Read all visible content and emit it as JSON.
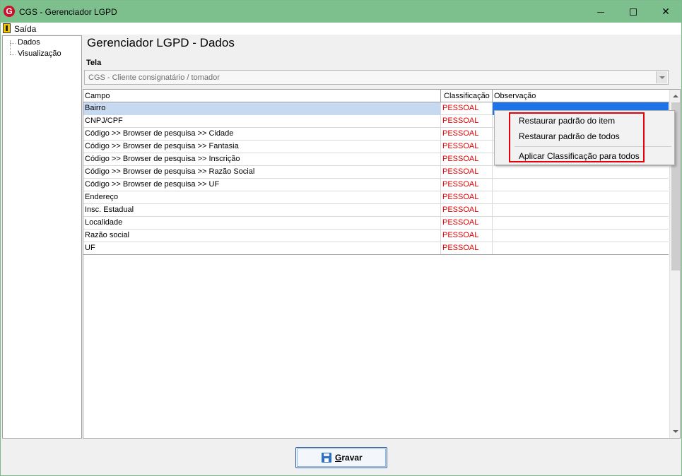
{
  "window": {
    "title": "CGS - Gerenciador LGPD",
    "app_icon_letter": "G"
  },
  "menubar": {
    "exit_label": "Saída"
  },
  "tree": {
    "items": [
      {
        "label": "Dados"
      },
      {
        "label": "Visualização"
      }
    ]
  },
  "main": {
    "heading": "Gerenciador LGPD - Dados",
    "tela_label": "Tela",
    "tela_value": "CGS - Cliente consignatário / tomador"
  },
  "grid": {
    "columns": [
      "Campo",
      "Classificação",
      "Observação"
    ],
    "rows": [
      {
        "campo": "Bairro",
        "classificacao": "PESSOAL",
        "observacao": ""
      },
      {
        "campo": "CNPJ/CPF",
        "classificacao": "PESSOAL",
        "observacao": ""
      },
      {
        "campo": "Código >> Browser de pesquisa >> Cidade",
        "classificacao": "PESSOAL",
        "observacao": ""
      },
      {
        "campo": "Código >> Browser de pesquisa >> Fantasia",
        "classificacao": "PESSOAL",
        "observacao": ""
      },
      {
        "campo": "Código >> Browser de pesquisa >> Inscrição",
        "classificacao": "PESSOAL",
        "observacao": ""
      },
      {
        "campo": "Código >> Browser de pesquisa >> Razão Social",
        "classificacao": "PESSOAL",
        "observacao": ""
      },
      {
        "campo": "Código >> Browser de pesquisa >> UF",
        "classificacao": "PESSOAL",
        "observacao": ""
      },
      {
        "campo": "Endereço",
        "classificacao": "PESSOAL",
        "observacao": ""
      },
      {
        "campo": "Insc. Estadual",
        "classificacao": "PESSOAL",
        "observacao": ""
      },
      {
        "campo": "Localidade",
        "classificacao": "PESSOAL",
        "observacao": ""
      },
      {
        "campo": "Razão social",
        "classificacao": "PESSOAL",
        "observacao": ""
      },
      {
        "campo": "UF",
        "classificacao": "PESSOAL",
        "observacao": ""
      }
    ],
    "selected_row": 0,
    "classification_color": "#e00000"
  },
  "context_menu": {
    "items": [
      {
        "label": "Restaurar padrão do item"
      },
      {
        "label": "Restaurar padrão de todos"
      },
      {
        "label": "Aplicar Classificação para todos"
      }
    ],
    "highlight_color": "#e8000b"
  },
  "footer": {
    "save_label_underlined": "G",
    "save_label_rest": "ravar",
    "save_icon": "floppy-disk-icon"
  },
  "colors": {
    "titlebar": "#7dc08d",
    "selection": "#1e73e8"
  }
}
